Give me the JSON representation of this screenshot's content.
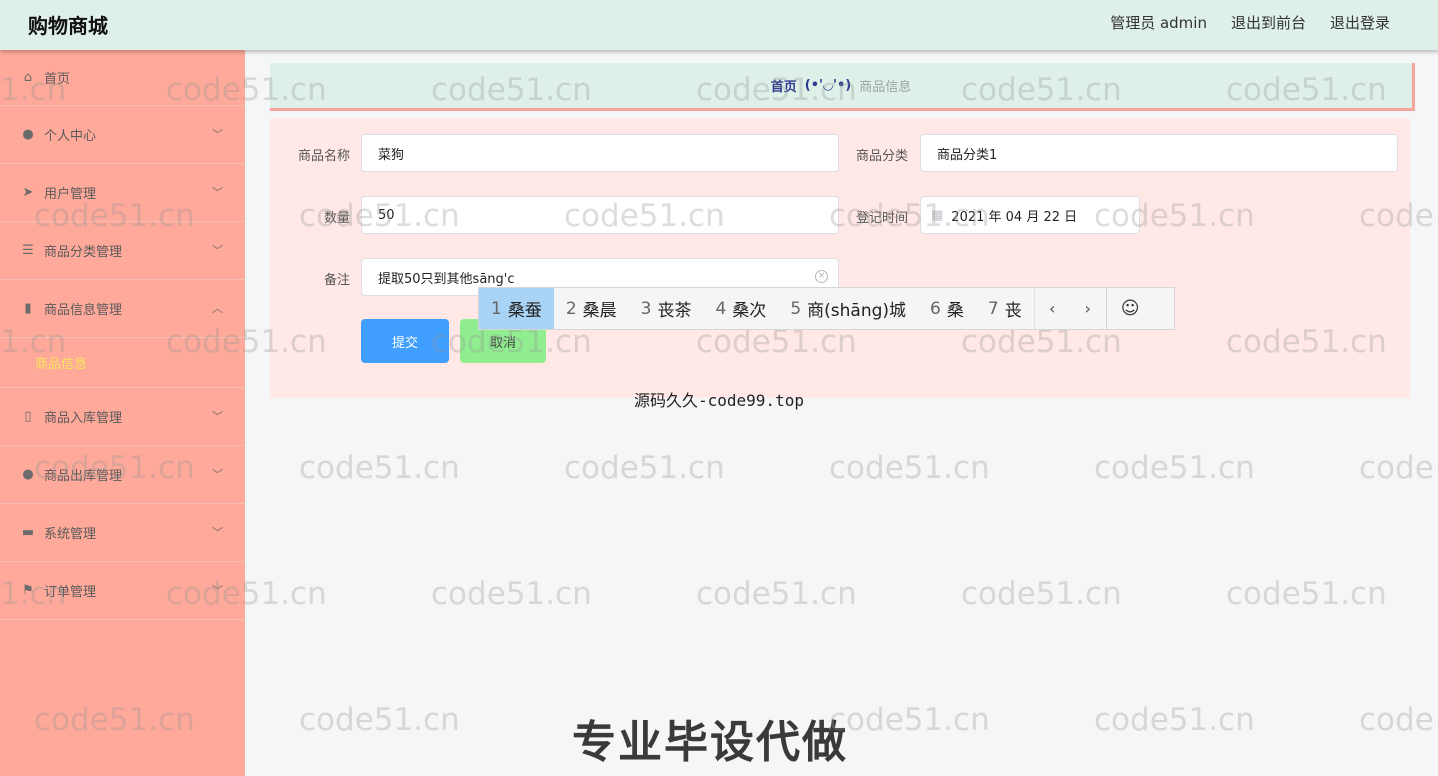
{
  "header": {
    "title": "购物商城",
    "nav": [
      "管理员 admin",
      "退出到前台",
      "退出登录"
    ]
  },
  "sidebar": {
    "items": [
      {
        "label": "首页",
        "icon": "home-icon",
        "chevron": ""
      },
      {
        "label": "个人中心",
        "icon": "user-icon",
        "chevron": "﹀"
      },
      {
        "label": "用户管理",
        "icon": "send-icon",
        "chevron": "﹀"
      },
      {
        "label": "商品分类管理",
        "icon": "sliders-icon",
        "chevron": "﹀"
      },
      {
        "label": "商品信息管理",
        "icon": "bar-chart-icon",
        "chevron": "︿"
      },
      {
        "label": "商品入库管理",
        "icon": "phone-icon",
        "chevron": "﹀"
      },
      {
        "label": "商品出库管理",
        "icon": "bulb-icon",
        "chevron": "﹀"
      },
      {
        "label": "系统管理",
        "icon": "ticket-icon",
        "chevron": "﹀"
      },
      {
        "label": "订单管理",
        "icon": "flag-icon",
        "chevron": "﹀"
      }
    ],
    "active_submenu": "商品信息"
  },
  "breadcrumb": {
    "home": "首页",
    "separator": "(•'◡'•)",
    "current": "商品信息"
  },
  "form": {
    "name_label": "商品名称",
    "name_value": "菜狗",
    "category_label": "商品分类",
    "category_value": "商品分类1",
    "quantity_label": "数量",
    "quantity_value": "50",
    "date_label": "登记时间",
    "date_value": "2021 年 04 月 22 日",
    "remark_label": "备注",
    "remark_value": "提取50只到其他sāng'c",
    "submit_label": "提交",
    "cancel_label": "取消"
  },
  "ime": {
    "candidates": [
      {
        "num": "1",
        "text": "桑蚕"
      },
      {
        "num": "2",
        "text": "桑晨"
      },
      {
        "num": "3",
        "text": "丧茶"
      },
      {
        "num": "4",
        "text": "桑次"
      },
      {
        "num": "5",
        "text": "商(shāng)城"
      },
      {
        "num": "6",
        "text": "桑"
      },
      {
        "num": "7",
        "text": "丧"
      }
    ],
    "prev": "‹",
    "next": "›",
    "emoji": "☺"
  },
  "overlay": {
    "caption": "源码久久-code99.top",
    "promo": "专业毕设代做",
    "watermark": "code51.cn",
    "watermark_partial_left": "1.cn",
    "watermark_partial_right": "code"
  }
}
